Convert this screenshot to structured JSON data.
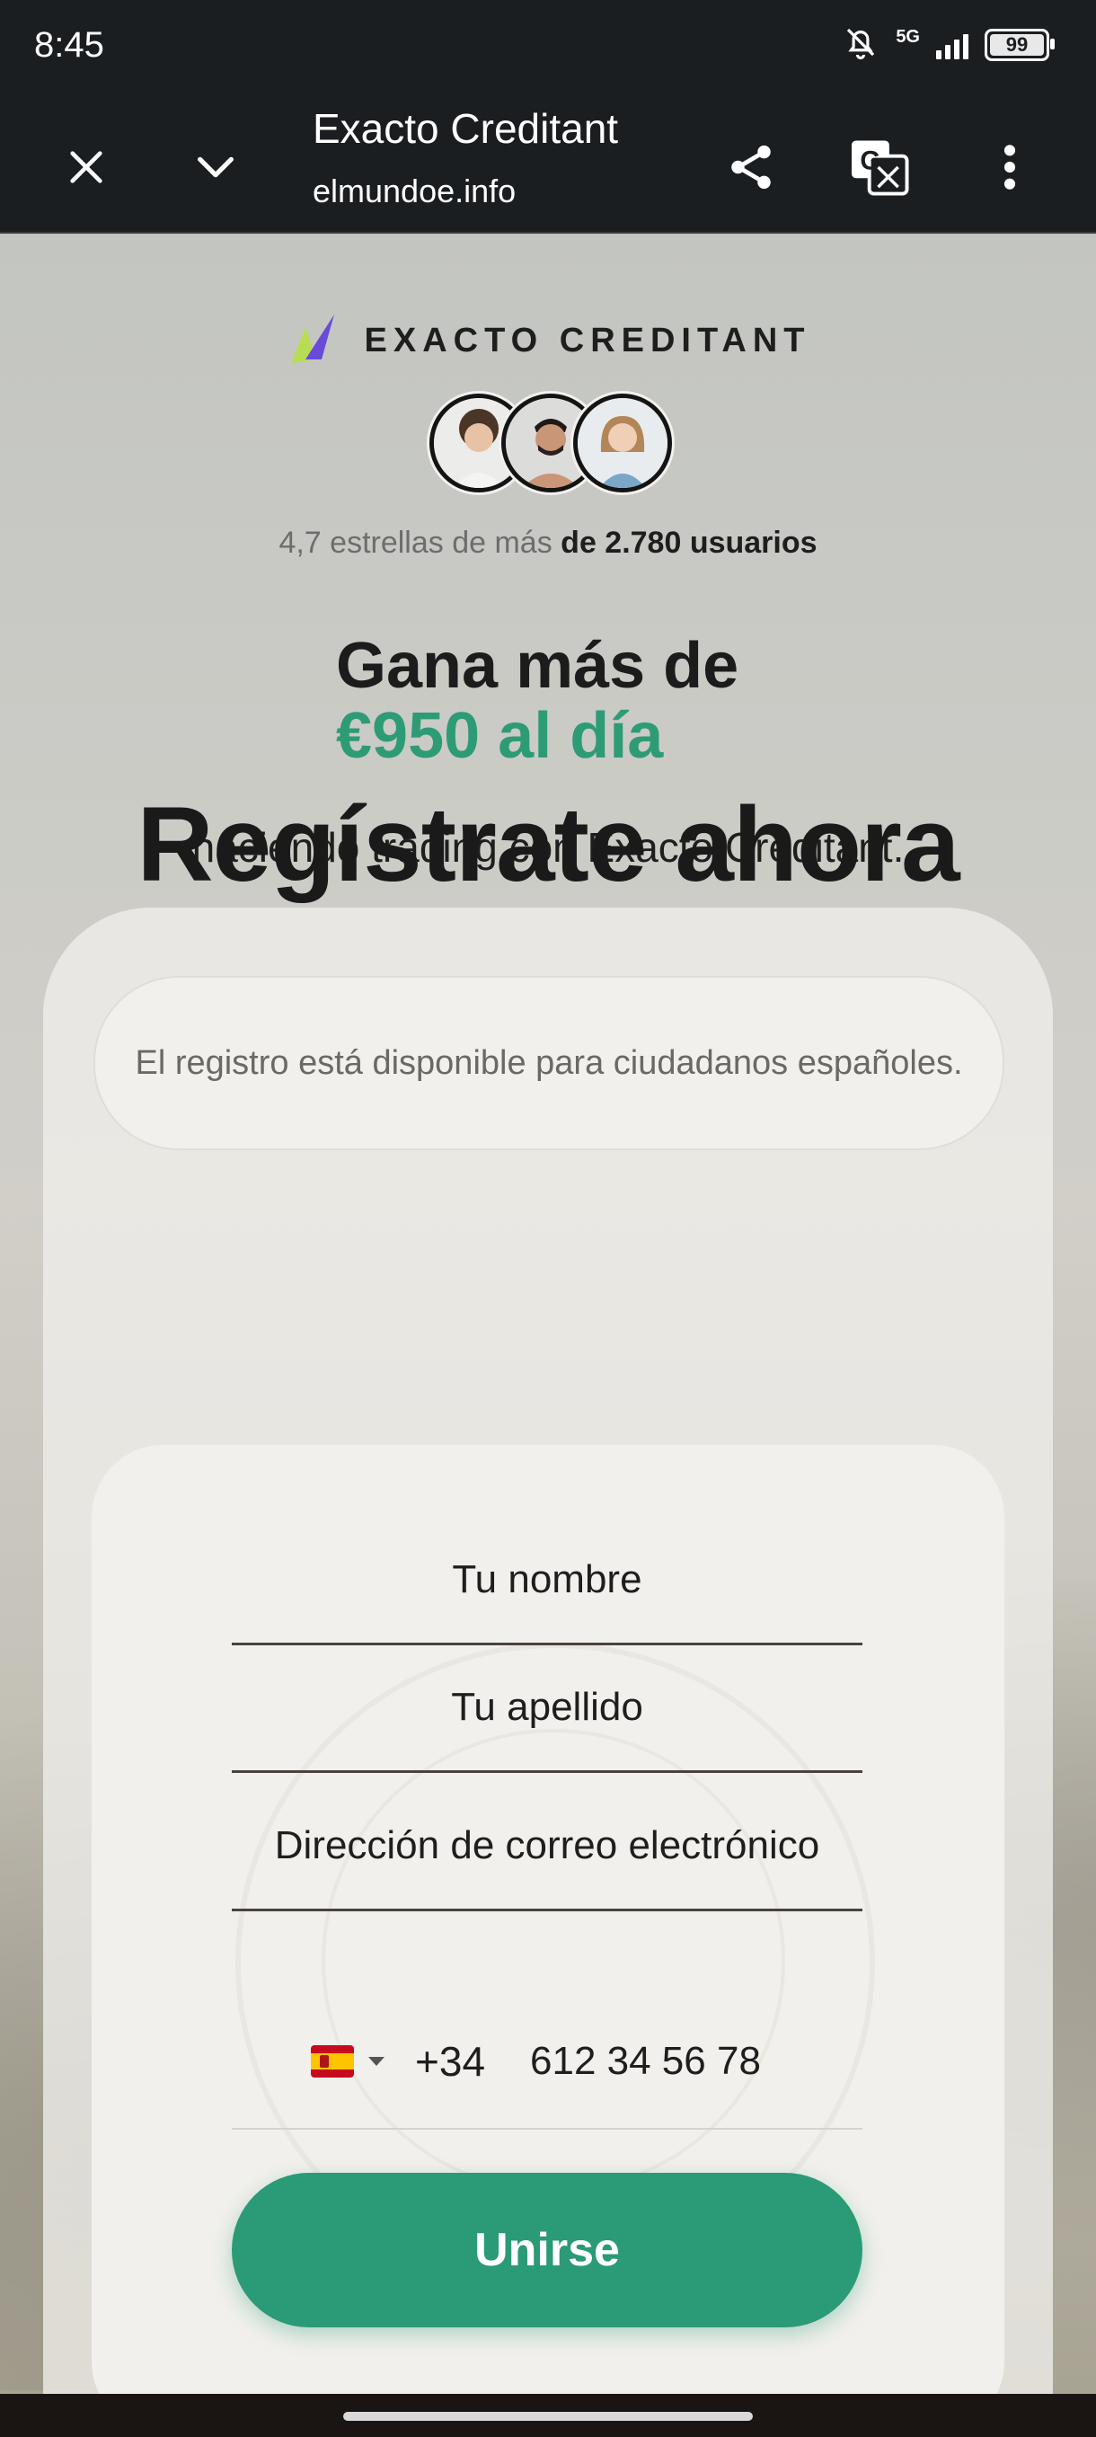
{
  "status_bar": {
    "time": "8:45",
    "network": "5G",
    "battery": "99"
  },
  "browser": {
    "title": "Exacto Creditant",
    "url": "elmundoe.info",
    "icons": [
      "close-icon",
      "chevron-down-icon",
      "share-icon",
      "translate-icon",
      "more-vert-icon"
    ]
  },
  "brand": {
    "name": "EXACTO CREDITANT"
  },
  "rating": {
    "prefix": "4,7 estrellas de más",
    "strong": "de 2.780 usuarios"
  },
  "hero": {
    "headline": "Gana más de",
    "accent": "€950 al día",
    "subline": "haciendo trading con Exacto Creditant."
  },
  "notice": "El registro está disponible para ciudadanos españoles.",
  "register_title": "Regístrate ahora",
  "form": {
    "first_name_placeholder": "Tu nombre",
    "last_name_placeholder": "Tu apellido",
    "email_placeholder": "Dirección de correo electrónico",
    "dial_code": "+34",
    "phone_placeholder": "612 34 56 78",
    "submit_label": "Unirse"
  },
  "colors": {
    "accent": "#2e9b77",
    "button": "#2a9a77",
    "toolbar": "#1b1e21"
  }
}
